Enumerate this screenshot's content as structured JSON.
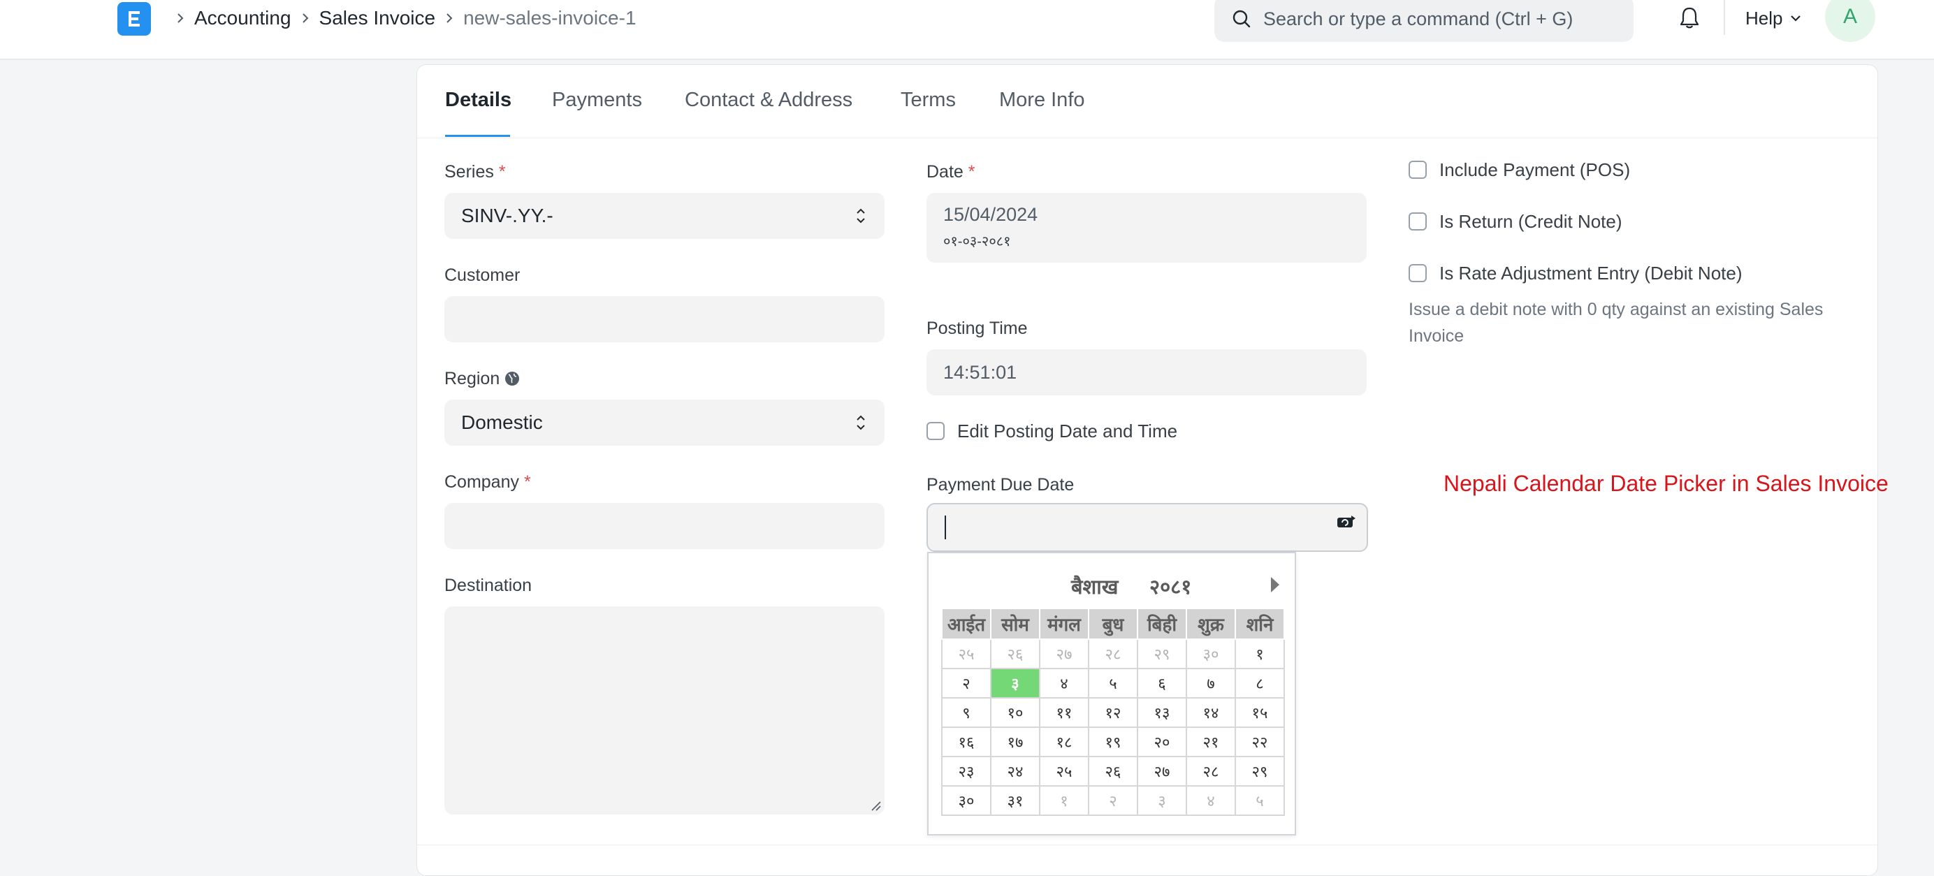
{
  "breadcrumbs": [
    "Accounting",
    "Sales Invoice",
    "new-sales-invoice-1"
  ],
  "search": {
    "placeholder": "Search or type a command (Ctrl + G)"
  },
  "nav": {
    "help_label": "Help",
    "avatar_initial": "A",
    "logo_letter": "E"
  },
  "tabs": [
    "Details",
    "Payments",
    "Contact & Address",
    "Terms",
    "More Info"
  ],
  "form": {
    "series_label": "Series",
    "series_value": "SINV-.YY.-",
    "customer_label": "Customer",
    "customer_value": "",
    "region_label": "Region",
    "region_value": "Domestic",
    "company_label": "Company",
    "company_value": "",
    "destination_label": "Destination",
    "destination_value": "",
    "date_label": "Date",
    "date_value": "15/04/2024",
    "date_nepali": "०१-०३-२०८१",
    "posting_time_label": "Posting Time",
    "posting_time_value": "14:51:01",
    "edit_posting_label": "Edit Posting Date and Time",
    "payment_due_label": "Payment Due Date",
    "payment_due_value": "",
    "include_payment_label": "Include Payment (POS)",
    "is_return_label": "Is Return (Credit Note)",
    "rate_adjustment_label": "Is Rate Adjustment Entry (Debit Note)",
    "rate_adjustment_desc": "Issue a debit note with 0 qty against an existing Sales Invoice",
    "required_mark": "*"
  },
  "annotation": "Nepali Calendar Date Picker in Sales Invoice",
  "calendar": {
    "month": "बैशाख",
    "year": "२०८१",
    "weekdays": [
      "आईत",
      "सोम",
      "मंगल",
      "बुध",
      "बिही",
      "शुक्र",
      "शनि"
    ],
    "weeks": [
      [
        {
          "d": "२५",
          "m": true
        },
        {
          "d": "२६",
          "m": true
        },
        {
          "d": "२७",
          "m": true
        },
        {
          "d": "२८",
          "m": true
        },
        {
          "d": "२९",
          "m": true
        },
        {
          "d": "३०",
          "m": true
        },
        {
          "d": "१"
        }
      ],
      [
        {
          "d": "२"
        },
        {
          "d": "३",
          "t": true
        },
        {
          "d": "४"
        },
        {
          "d": "५"
        },
        {
          "d": "६"
        },
        {
          "d": "७"
        },
        {
          "d": "८"
        }
      ],
      [
        {
          "d": "९"
        },
        {
          "d": "१०"
        },
        {
          "d": "११"
        },
        {
          "d": "१२"
        },
        {
          "d": "१३"
        },
        {
          "d": "१४"
        },
        {
          "d": "१५"
        }
      ],
      [
        {
          "d": "१६"
        },
        {
          "d": "१७"
        },
        {
          "d": "१८"
        },
        {
          "d": "१९"
        },
        {
          "d": "२०"
        },
        {
          "d": "२१"
        },
        {
          "d": "२२"
        }
      ],
      [
        {
          "d": "२३"
        },
        {
          "d": "२४"
        },
        {
          "d": "२५"
        },
        {
          "d": "२६"
        },
        {
          "d": "२७"
        },
        {
          "d": "२८"
        },
        {
          "d": "२९"
        }
      ],
      [
        {
          "d": "३०"
        },
        {
          "d": "३१"
        },
        {
          "d": "१",
          "m": true
        },
        {
          "d": "२",
          "m": true
        },
        {
          "d": "३",
          "m": true
        },
        {
          "d": "४",
          "m": true
        },
        {
          "d": "५",
          "m": true
        }
      ]
    ]
  },
  "colors": {
    "accent": "#2490ef",
    "today": "#75d876",
    "annotation": "#d9141a",
    "required": "#e24c4c"
  }
}
